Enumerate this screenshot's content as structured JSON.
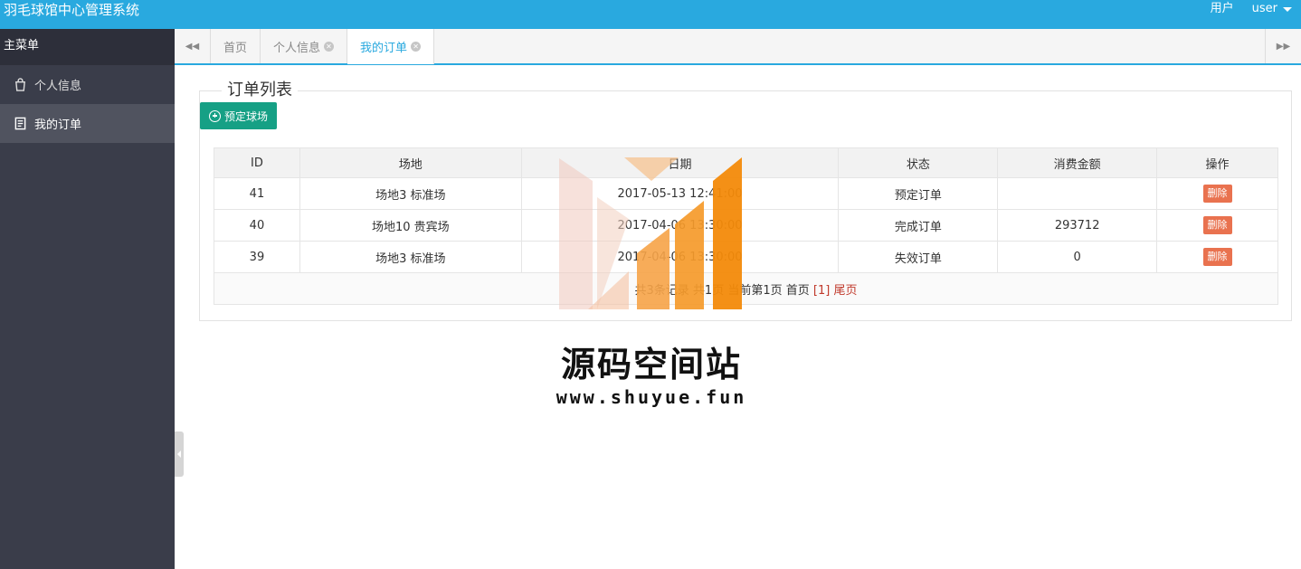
{
  "header": {
    "app_title": "羽毛球馆中心管理系统",
    "user_label": "用户",
    "username": "user"
  },
  "sidebar": {
    "title": "主菜单",
    "items": [
      {
        "label": "个人信息",
        "icon": "bag-icon",
        "active": false
      },
      {
        "label": "我的订单",
        "icon": "document-icon",
        "active": true
      }
    ]
  },
  "tabs": [
    {
      "label": "首页",
      "closable": false,
      "active": false
    },
    {
      "label": "个人信息",
      "closable": true,
      "active": false
    },
    {
      "label": "我的订单",
      "closable": true,
      "active": true
    }
  ],
  "order_panel": {
    "legend": "订单列表",
    "book_button": "预定球场",
    "columns": [
      "ID",
      "场地",
      "日期",
      "状态",
      "消费金额",
      "操作"
    ],
    "rows": [
      {
        "id": "41",
        "venue": "场地3 标准场",
        "date": "2017-05-13 12:41:00",
        "status": "预定订单",
        "amount": "",
        "action": "删除"
      },
      {
        "id": "40",
        "venue": "场地10 贵宾场",
        "date": "2017-04-06 13:30:00",
        "status": "完成订单",
        "amount": "293712",
        "action": "删除"
      },
      {
        "id": "39",
        "venue": "场地3 标准场",
        "date": "2017-04-06 13:30:00",
        "status": "失效订单",
        "amount": "0",
        "action": "删除"
      }
    ],
    "pager": {
      "summary": "共3条记录 共1页 当前第1页",
      "first": "首页",
      "current": "[1]",
      "last": "尾页"
    }
  },
  "watermark": {
    "title": "源码空间站",
    "url": "www.shuyue.fun"
  },
  "colors": {
    "header_bg": "#29a9df",
    "sidebar_bg": "#3a3d4a",
    "book_button": "#16a085",
    "delete_button": "#e9724f"
  }
}
